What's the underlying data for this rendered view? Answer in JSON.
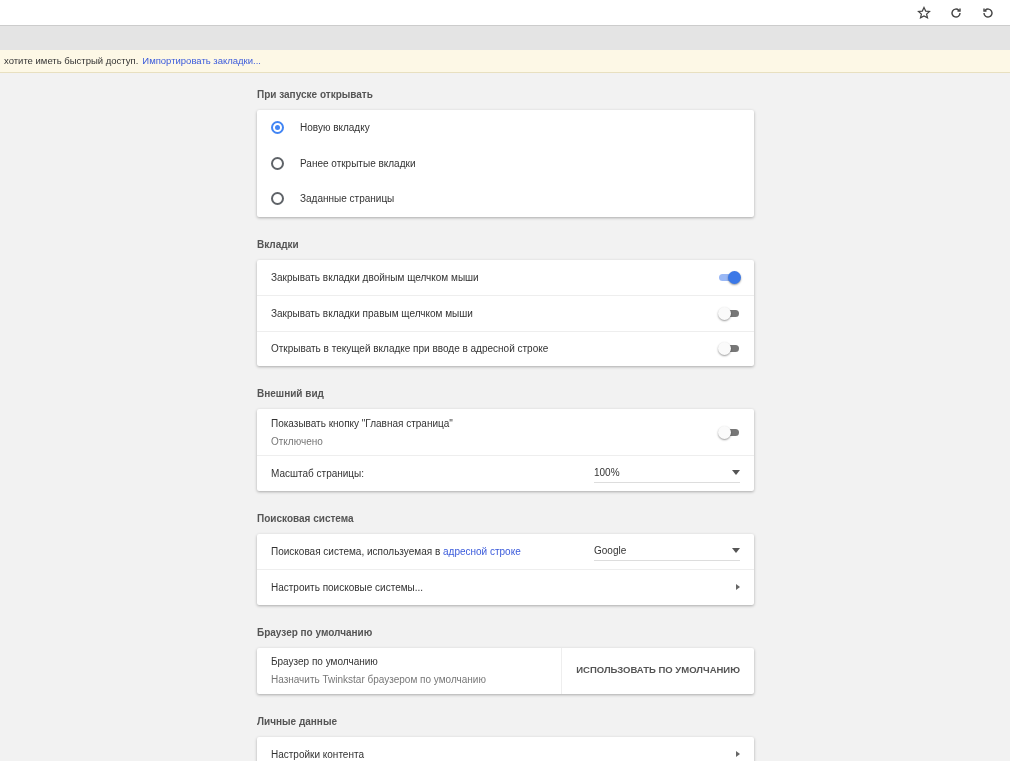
{
  "infobar": {
    "text": "хотите иметь быстрый доступ.",
    "link": "Импортировать закладки..."
  },
  "sections": [
    {
      "title": "При запуске открывать",
      "rows": [
        {
          "kind": "radio",
          "label": "Новую вкладку",
          "selected": true
        },
        {
          "kind": "radio",
          "label": "Ранее открытые вкладки",
          "selected": false
        },
        {
          "kind": "radio",
          "label": "Заданные страницы",
          "selected": false
        }
      ]
    },
    {
      "title": "Вкладки",
      "rows": [
        {
          "kind": "toggle",
          "label": "Закрывать вкладки двойным щелчком мыши",
          "on": true
        },
        {
          "kind": "toggle",
          "label": "Закрывать вкладки правым щелчком мыши",
          "on": false
        },
        {
          "kind": "toggle",
          "label": "Открывать в текущей вкладке при вводе в адресной строке",
          "on": false
        }
      ]
    },
    {
      "title": "Внешний вид",
      "rows": [
        {
          "kind": "toggle",
          "label": "Показывать кнопку \"Главная страница\"",
          "sublabel": "Отключено",
          "on": false
        },
        {
          "kind": "select",
          "label": "Масштаб страницы:",
          "value": "100%"
        }
      ]
    },
    {
      "title": "Поисковая система",
      "rows": [
        {
          "kind": "select",
          "label": "Поисковая система, используемая в",
          "link": "адресной строке",
          "value": "Google"
        },
        {
          "kind": "nav",
          "label": "Настроить поисковые системы..."
        }
      ]
    },
    {
      "title": "Браузер по умолчанию",
      "rows": [
        {
          "kind": "action",
          "label": "Браузер по умолчанию",
          "sublabel": "Назначить Twinkstar браузером по умолчанию",
          "button": "ИСПОЛЬЗОВАТЬ ПО УМОЛЧАНИЮ"
        }
      ]
    },
    {
      "title": "Личные данные",
      "rows": [
        {
          "kind": "nav",
          "label": "Настройки контента"
        }
      ]
    }
  ]
}
